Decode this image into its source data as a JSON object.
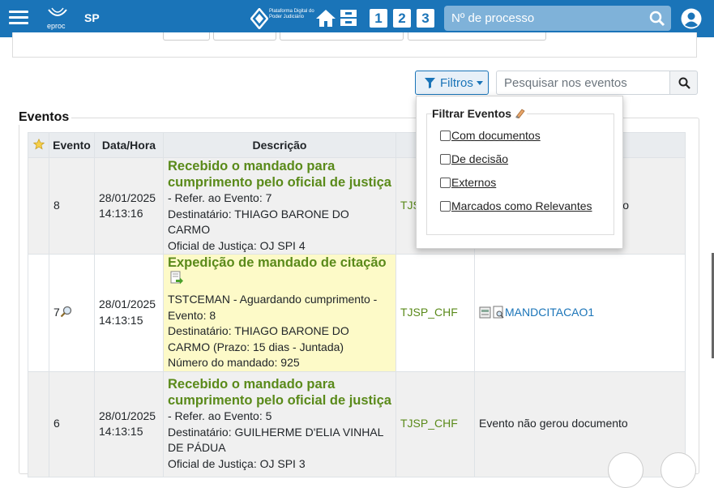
{
  "header": {
    "logo_text": "eproc",
    "state": "SP",
    "platform_logo_text": "Plataforma Digital do Poder Judiciário",
    "shortcuts": [
      "1",
      "2",
      "3"
    ],
    "process_search_placeholder": "Nº de processo"
  },
  "toolbar": {
    "filters_label": "Filtros",
    "event_search_placeholder": "Pesquisar nos eventos"
  },
  "events": {
    "section_title": "Eventos",
    "columns": [
      "Evento",
      "Data/Hora",
      "Descrição",
      "",
      ""
    ],
    "rows": [
      {
        "number": "8",
        "date": "28/01/2025",
        "time": "14:13:16",
        "title": "Recebido o mandado para cumprimento pelo oficial de justiça",
        "lines": [
          "- Refer. ao Evento: 7",
          "Destinatário: THIAGO BARONE DO CARMO",
          "Oficial de Justiça: OJ SPI 4"
        ],
        "org": "TJSP",
        "doc": "o"
      },
      {
        "number": "7",
        "date": "28/01/2025",
        "time": "14:13:15",
        "title": "Expedição de mandado de citação",
        "lines": [
          "TSTCEMAN - Aguardando cumprimento - Evento: 8",
          "Destinatário: THIAGO BARONE DO CARMO (Prazo: 15 dias - Juntada)",
          "Número do mandado: 925"
        ],
        "org": "TJSP_CHF",
        "doc": "MANDCITACAO1"
      },
      {
        "number": "6",
        "date": "28/01/2025",
        "time": "14:13:15",
        "title": "Recebido o mandado para cumprimento pelo oficial de justiça",
        "lines": [
          "- Refer. ao Evento: 5",
          "Destinatário: GUILHERME D'ELIA VINHAL DE PÁDUA",
          "Oficial de Justiça: OJ SPI 3"
        ],
        "org": "TJSP_CHF",
        "doc": "Evento não gerou documento"
      }
    ]
  },
  "filter_dropdown": {
    "title": "Filtrar Eventos",
    "options": [
      "Com documentos",
      "De decisão",
      "Externos",
      "Marcados como Relevantes"
    ]
  },
  "colors": {
    "header_bg": "#1a74b8",
    "event_title": "#5a8a1a",
    "highlight_row": "#fdfac8",
    "link": "#1a74b8"
  }
}
